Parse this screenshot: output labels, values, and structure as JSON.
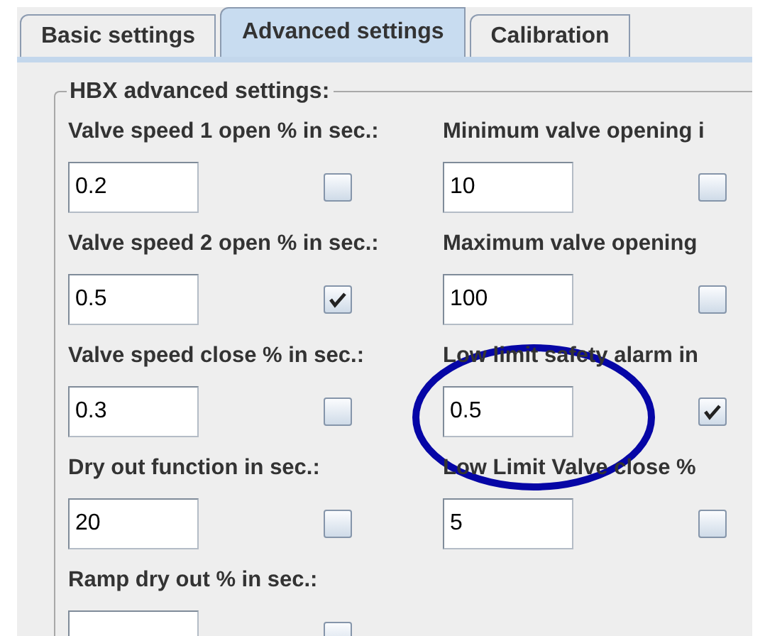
{
  "tabs": [
    {
      "label": "Basic settings",
      "selected": false
    },
    {
      "label": "Advanced settings",
      "selected": true
    },
    {
      "label": "Calibration",
      "selected": false
    }
  ],
  "group": {
    "title": "HBX advanced settings:"
  },
  "settings": [
    {
      "label": "Valve speed 1 open % in sec.:",
      "value": "0.2",
      "checked": false
    },
    {
      "label": "Minimum valve opening i",
      "value": "10",
      "checked": false
    },
    {
      "label": "Valve speed 2 open % in sec.:",
      "value": "0.5",
      "checked": true
    },
    {
      "label": "Maximum valve opening",
      "value": "100",
      "checked": false
    },
    {
      "label": "Valve speed close % in sec.:",
      "value": "0.3",
      "checked": false
    },
    {
      "label": "Low limit safety alarm in",
      "value": "0.5",
      "checked": true
    },
    {
      "label": "Dry out function in sec.:",
      "value": "20",
      "checked": false
    },
    {
      "label": "Low Limit Valve close %",
      "value": "5",
      "checked": false
    },
    {
      "label": "Ramp dry out % in sec.:",
      "checked": false
    }
  ]
}
